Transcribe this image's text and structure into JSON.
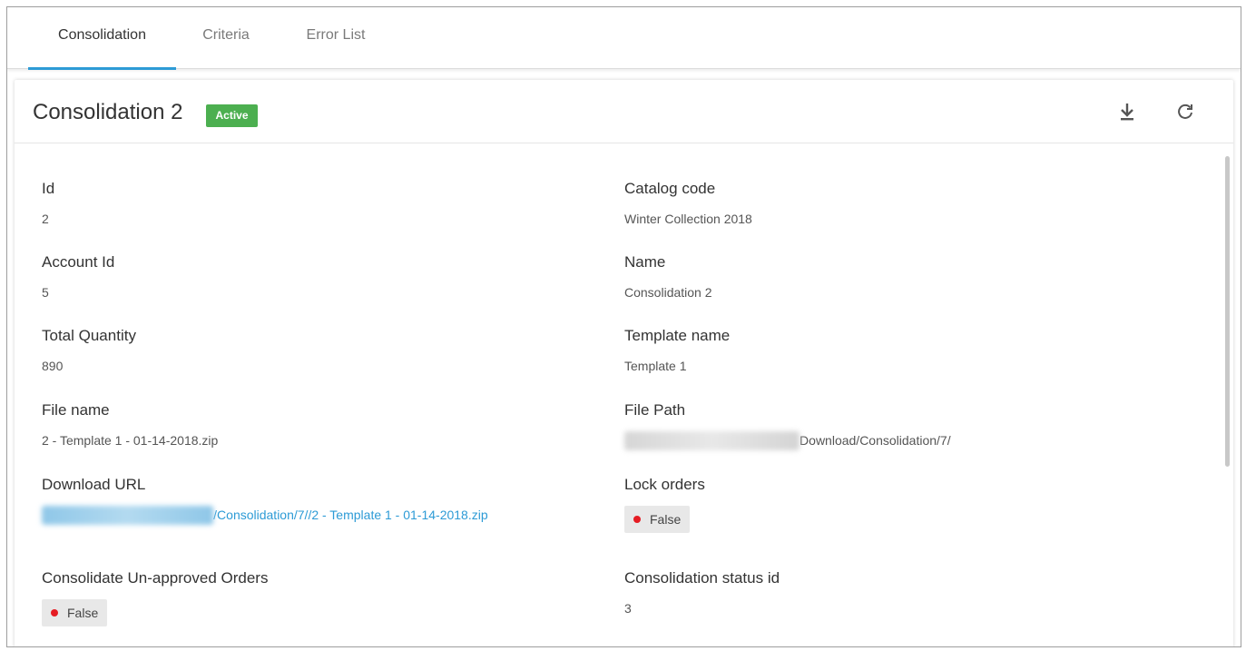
{
  "tabs": [
    {
      "label": "Consolidation",
      "active": true
    },
    {
      "label": "Criteria",
      "active": false
    },
    {
      "label": "Error List",
      "active": false
    }
  ],
  "header": {
    "title": "Consolidation 2",
    "status_badge": "Active",
    "status_color": "#4caf50",
    "actions": [
      "download-icon",
      "refresh-icon"
    ]
  },
  "fields": {
    "id": {
      "label": "Id",
      "value": "2"
    },
    "catalog_code": {
      "label": "Catalog code",
      "value": "Winter Collection 2018"
    },
    "account_id": {
      "label": "Account Id",
      "value": "5"
    },
    "name": {
      "label": "Name",
      "value": "Consolidation 2"
    },
    "total_quantity": {
      "label": "Total Quantity",
      "value": "890"
    },
    "template_name": {
      "label": "Template name",
      "value": "Template 1"
    },
    "file_name": {
      "label": "File name",
      "value": "2 - Template 1 - 01-14-2018.zip"
    },
    "file_path": {
      "label": "File Path",
      "value_visible": "Download/Consolidation/7/"
    },
    "download_url": {
      "label": "Download URL",
      "value_visible": "/Consolidation/7//2 - Template 1 - 01-14-2018.zip"
    },
    "lock_orders": {
      "label": "Lock orders",
      "value": "False"
    },
    "consolidate_unapproved": {
      "label": "Consolidate Un-approved Orders",
      "value": "False"
    },
    "consolidation_status_id": {
      "label": "Consolidation status id",
      "value": "3"
    }
  },
  "colors": {
    "accent": "#2d9bd6",
    "false_dot": "#e51c23"
  }
}
